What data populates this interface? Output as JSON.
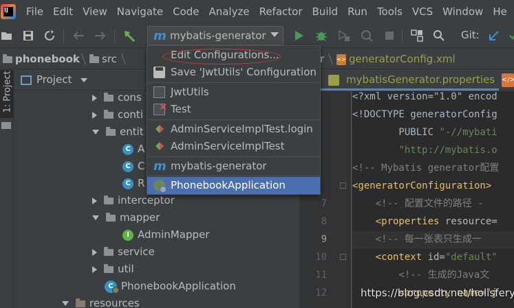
{
  "menubar": {
    "items": [
      "File",
      "Edit",
      "View",
      "Navigate",
      "Code",
      "Analyze",
      "Refactor",
      "Build",
      "Run",
      "Tools",
      "VCS",
      "Window",
      "He"
    ]
  },
  "toolbar": {
    "run_config_label": "mybatis-generator",
    "git_label": "Git:",
    "icons": [
      "open-folder-icon",
      "save-icon",
      "sync-icon",
      "back-icon",
      "forward-icon",
      "build-hammer-icon",
      "run-icon",
      "debug-icon",
      "coverage-icon",
      "profile-icon",
      "stop-icon",
      "project-structure-icon",
      "search-icon",
      "git-update-icon",
      "git-commit-icon"
    ]
  },
  "breadcrumb": {
    "items": [
      "phonebook",
      "src",
      "r",
      "generatorConfig.xml"
    ]
  },
  "tool_strip": {
    "project_tab": "1: Project"
  },
  "project_panel": {
    "title": "Project",
    "rows": [
      {
        "label": "cons",
        "icon": "folder-icon",
        "expander": "collapsed"
      },
      {
        "label": "conti",
        "icon": "folder-icon",
        "expander": "collapsed"
      },
      {
        "label": "entit",
        "icon": "folder-icon",
        "expander": "expanded"
      },
      {
        "label": "A",
        "icon": "class-icon",
        "expander": "none"
      },
      {
        "label": "C",
        "icon": "class-icon",
        "expander": "none"
      },
      {
        "label": "R",
        "icon": "class-icon",
        "expander": "none"
      },
      {
        "label": "interceptor",
        "icon": "folder-icon",
        "expander": "collapsed"
      },
      {
        "label": "mapper",
        "icon": "folder-icon",
        "expander": "expanded"
      },
      {
        "label": "AdminMapper",
        "icon": "interface-icon",
        "expander": "none"
      },
      {
        "label": "service",
        "icon": "folder-icon",
        "expander": "collapsed"
      },
      {
        "label": "util",
        "icon": "folder-icon",
        "expander": "collapsed"
      },
      {
        "label": "PhonebookApplication",
        "icon": "spring-app-icon",
        "expander": "none"
      },
      {
        "label": "resources",
        "icon": "resources-folder-icon",
        "expander": "expanded"
      }
    ]
  },
  "editor": {
    "active_tab": "mybatisGenerator.properties",
    "line_numbers": [
      "",
      "",
      "",
      "",
      "",
      "",
      "7",
      "8",
      "9",
      "10",
      "11",
      "12"
    ],
    "current_line": "9",
    "code_lines": [
      [
        {
          "t": "<?xml version=\"1.0\" encod",
          "c": "c-doc"
        }
      ],
      [
        {
          "t": "<!DOCTYPE generatorConfig",
          "c": "c-doc"
        }
      ],
      [
        {
          "t": "        PUBLIC ",
          "c": "c-doc"
        },
        {
          "t": "\"-//mybati",
          "c": "c-str"
        }
      ],
      [
        {
          "t": "        ",
          "c": "c-doc"
        },
        {
          "t": "\"http://mybatis.o",
          "c": "c-str"
        }
      ],
      [
        {
          "t": "<!-- Mybatis generator配置",
          "c": "c-cmt"
        }
      ],
      [
        {
          "t": "<generatorConfiguration>",
          "c": "c-tag"
        }
      ],
      [
        {
          "t": "    <!-- 配置文件的路径 -",
          "c": "c-cmt"
        }
      ],
      [
        {
          "t": "    <properties ",
          "c": "c-tag"
        },
        {
          "t": "resource=",
          "c": "c-attr"
        }
      ],
      [
        {
          "t": "    <!-- 每一张表只生成一",
          "c": "c-cmt"
        }
      ],
      [
        {
          "t": "    <context ",
          "c": "c-tag"
        },
        {
          "t": "id=",
          "c": "c-attr"
        },
        {
          "t": "\"default\"",
          "c": "c-str"
        }
      ],
      [
        {
          "t": "        <!-- 生成的Java文",
          "c": "c-cmt"
        }
      ],
      [
        {
          "t": "        <property name=\"j",
          "c": "c-tag"
        }
      ]
    ]
  },
  "run_config_dropdown": {
    "items": [
      {
        "label": "Edit Configurations...",
        "icon": "none"
      },
      {
        "label": "Save 'JwtUtils' Configuration",
        "icon": "save-icon"
      },
      {
        "label": "JwtUtils",
        "icon": "junit-icon"
      },
      {
        "label": "Test",
        "icon": "test-failed-icon"
      },
      {
        "label": "AdminServiceImplTest.login",
        "icon": "test-diamond-icon"
      },
      {
        "label": "AdminServiceImplTest",
        "icon": "test-diamond-icon"
      },
      {
        "label": "mybatis-generator",
        "icon": "maven-icon"
      },
      {
        "label": "PhonebookApplication",
        "icon": "spring-boot-icon"
      }
    ],
    "selected": "PhonebookApplication"
  },
  "watermark": "https://blog.csdn.net/holisfery2",
  "colors": {
    "background": "#3c3f41",
    "editor_bg": "#2b2b2b",
    "selection": "#4b6eaf",
    "highlight_circle": "#d23a3a",
    "accent_blue": "#3d8fd6",
    "run_green": "#499c54"
  }
}
